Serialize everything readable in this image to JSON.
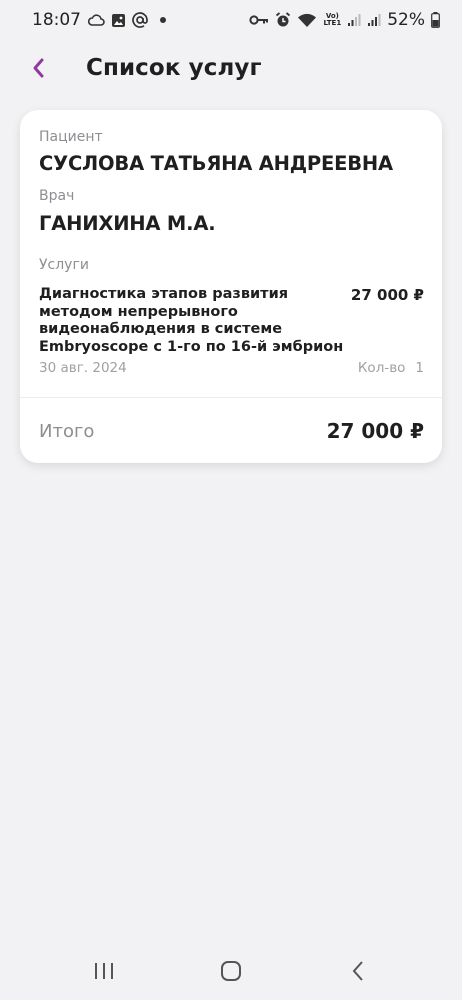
{
  "status_bar": {
    "time": "18:07",
    "battery": "52%",
    "lte_top": "Vo)",
    "lte_bottom": "LTE1"
  },
  "header": {
    "title": "Список услуг"
  },
  "card": {
    "patient_label": "Пациент",
    "patient_name": "СУСЛОВА ТАТЬЯНА АНДРЕЕВНА",
    "doctor_label": "Врач",
    "doctor_name": "ГАНИХИНА М.А.",
    "services_label": "Услуги",
    "services": [
      {
        "name": "Диагностика этапов развития методом непрерывного видеонаблюдения в системе Embryoscope с 1-го по 16-й эмбрион",
        "price": "27 000 ₽",
        "date": "30 авг. 2024",
        "qty_label": "Кол-во",
        "qty": "1"
      }
    ],
    "total_label": "Итого",
    "total_value": "27 000 ₽"
  },
  "colors": {
    "accent": "#8e3a9e",
    "background": "#f2f2f4",
    "card": "#ffffff",
    "muted_text": "#8e8e93"
  }
}
